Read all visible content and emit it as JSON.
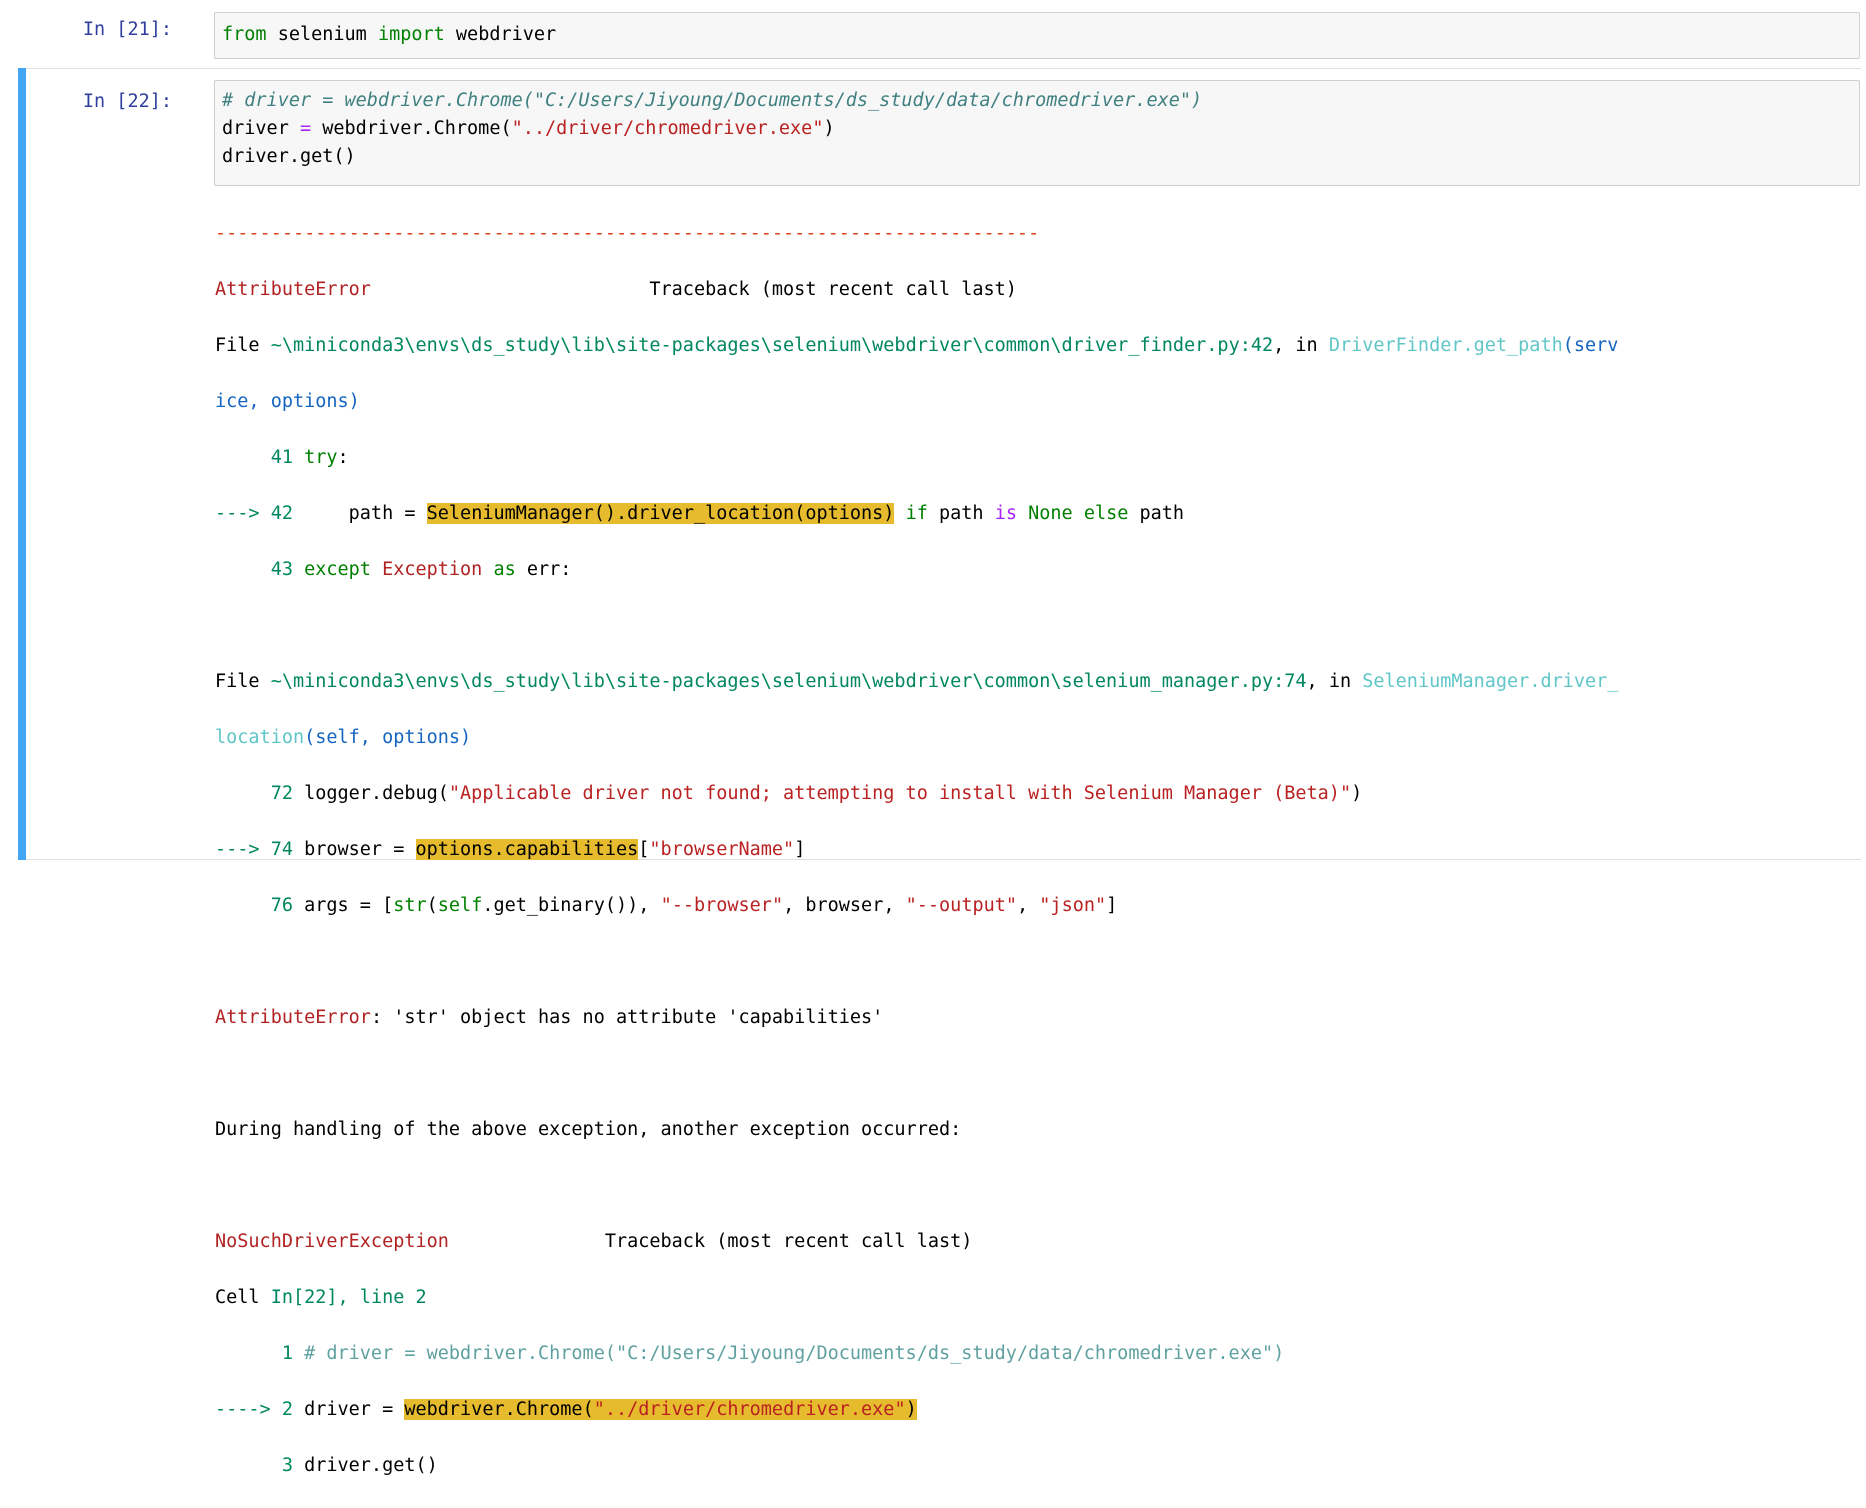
{
  "cell21": {
    "prompt": "In [21]:",
    "code": {
      "kw1": "from",
      "t1": " selenium ",
      "kw2": "import",
      "t2": " webdriver"
    }
  },
  "cell22": {
    "prompt": "In [22]:",
    "code_line1": "# driver = webdriver.Chrome(\"C:/Users/Jiyoung/Documents/ds_study/data/chromedriver.exe\")",
    "code_line2": {
      "a": "driver ",
      "op": "=",
      "b": " webdriver.Chrome(",
      "s": "\"../driver/chromedriver.exe\"",
      "c": ")"
    },
    "code_line3": "driver.get()"
  },
  "output": {
    "dashes": "--------------------------------------------------------------------------",
    "tb1": {
      "exc": "AttributeError",
      "header": "                         Traceback (most recent call last)",
      "file_prefix": "File ",
      "file_path": "~\\miniconda3\\envs\\ds_study\\lib\\site-packages\\selenium\\webdriver\\common\\driver_finder.py:42",
      "file_in": ", in ",
      "func": "DriverFinder.get_path",
      "args_a": "(serv",
      "args_b": "ice, options)",
      "l41_no": "     41 ",
      "l41_kw": "try",
      "l41_rest": ":",
      "l42_arrow": "---> 42 ",
      "l42_pre": "    path = ",
      "l42_hl": "SeleniumManager().driver_location(options)",
      "l42_sp": " ",
      "l42_if": "if",
      "l42_mid": " path ",
      "l42_is": "is",
      "l42_sp2": " ",
      "l42_none": "None",
      "l42_sp3": " ",
      "l42_else": "else",
      "l42_end": " path",
      "l43_no": "     43 ",
      "l43_kw": "except",
      "l43_sp": " ",
      "l43_exc": "Exception",
      "l43_sp2": " ",
      "l43_as": "as",
      "l43_end": " err:"
    },
    "tb2": {
      "file_prefix": "File ",
      "file_path": "~\\miniconda3\\envs\\ds_study\\lib\\site-packages\\selenium\\webdriver\\common\\selenium_manager.py:74",
      "file_in": ", in ",
      "func_a": "SeleniumManager.driver_",
      "func_b": "location",
      "args": "(self, options)",
      "l72_no": "     72 ",
      "l72_pre": "logger.debug(",
      "l72_str": "\"Applicable driver not found; attempting to install with Selenium Manager (Beta)\"",
      "l72_end": ")",
      "l74_arrow": "---> 74 ",
      "l74_pre": "browser = ",
      "l74_hl": "options.capabilities",
      "l74_b": "[",
      "l74_str": "\"browserName\"",
      "l74_end": "]",
      "l76_no": "     76 ",
      "l76_pre": "args = [",
      "l76_str_fn": "str",
      "l76_p": "(",
      "l76_self": "self",
      "l76_mid": ".get_binary()), ",
      "l76_s1": "\"--browser\"",
      "l76_c1": ", browser, ",
      "l76_s2": "\"--output\"",
      "l76_c2": ", ",
      "l76_s3": "\"json\"",
      "l76_end": "]"
    },
    "err_line": {
      "exc": "AttributeError",
      "msg": ": 'str' object has no attribute 'capabilities'"
    },
    "during": "During handling of the above exception, another exception occurred:",
    "tb3": {
      "exc": "NoSuchDriverException",
      "header": "              Traceback (most recent call last)",
      "cell_prefix": "Cell ",
      "cell_ref": "In[22], line 2",
      "l1_no": "      1 ",
      "l1_com": "# driver = webdriver.Chrome(\"C:/Users/Jiyoung/Documents/ds_study/data/chromedriver.exe\")",
      "l2_arrow": "----> 2 ",
      "l2_pre": "driver = ",
      "l2_hl_a": "webdriver.Chrome(",
      "l2_hl_str": "\"../driver/chromedriver.exe\"",
      "l2_hl_b": ")",
      "l3_no": "      3 ",
      "l3_code": "driver.get()"
    }
  },
  "colors": {
    "selection_bar": "#42a5f5",
    "prompt": "#303f9f",
    "highlight": "#e6bb2e",
    "error": "#b22222"
  }
}
